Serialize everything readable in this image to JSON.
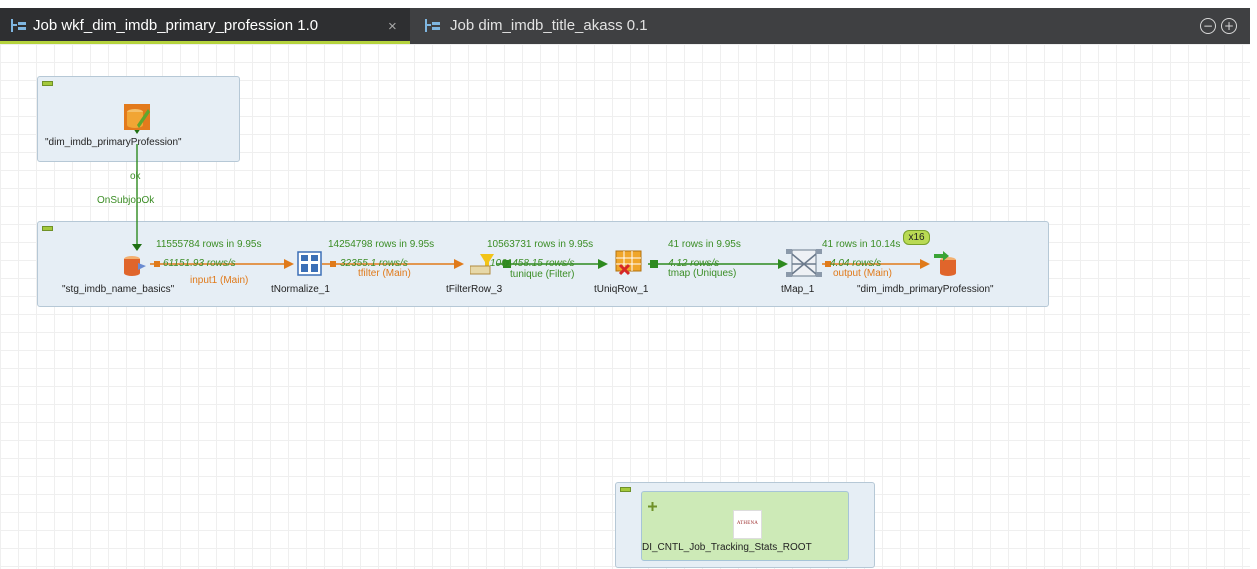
{
  "tabs": [
    {
      "label": "Job wkf_dim_imdb_primary_profession 1.0",
      "close": "×",
      "icon": "job-icon",
      "active": true
    },
    {
      "label": "Job dim_imdb_title_akass 0.1",
      "icon": "job-icon",
      "active": false
    }
  ],
  "window_buttons": {
    "minimize": "−",
    "maximize": "+"
  },
  "subjob1": {
    "component_label": "\"dim_imdb_primaryProfession\"",
    "trigger_ok": "ok",
    "trigger_label": "OnSubjobOk"
  },
  "subjob2": {
    "components": [
      {
        "label": "\"stg_imdb_name_basics\""
      },
      {
        "label": "tNormalize_1"
      },
      {
        "label": "tFilterRow_3"
      },
      {
        "label": "tUniqRow_1"
      },
      {
        "label": "tMap_1"
      },
      {
        "label": "\"dim_imdb_primaryProfession\""
      }
    ],
    "links": [
      {
        "stat": "11555784 rows in 9.95s",
        "rate": "61151.93 rows/s",
        "name": "input1 (Main)",
        "color": "#e07a1a"
      },
      {
        "stat": "14254798 rows in 9.95s",
        "rate": "32355.1 rows/s",
        "name": "tfilter (Main)",
        "color": "#e07a1a"
      },
      {
        "stat": "10563731 rows in 9.95s",
        "rate": "1061458.15 rows/s",
        "name": "tunique (Filter)",
        "color": "#3b8d25"
      },
      {
        "stat": "41 rows in 9.95s",
        "rate": "4.12 rows/s",
        "name": "tmap (Uniques)",
        "color": "#3b8d25"
      },
      {
        "stat": "41 rows in 10.14s",
        "rate": "4.04 rows/s",
        "name": "output (Main)",
        "color": "#e07a1a"
      }
    ],
    "parallel_badge": "x16"
  },
  "subjob3": {
    "component_label": "DI_CNTL_Job_Tracking_Stats_ROOT",
    "logo_text": "ATHENA"
  },
  "colors": {
    "tab_bar": "#3f4042",
    "tab_active_underline": "#b5d33d",
    "subjob_bg": "#e6eef5",
    "subjob_green_bg": "#cdeab7",
    "main_link": "#e07a1a",
    "filter_link": "#3b8d25"
  }
}
